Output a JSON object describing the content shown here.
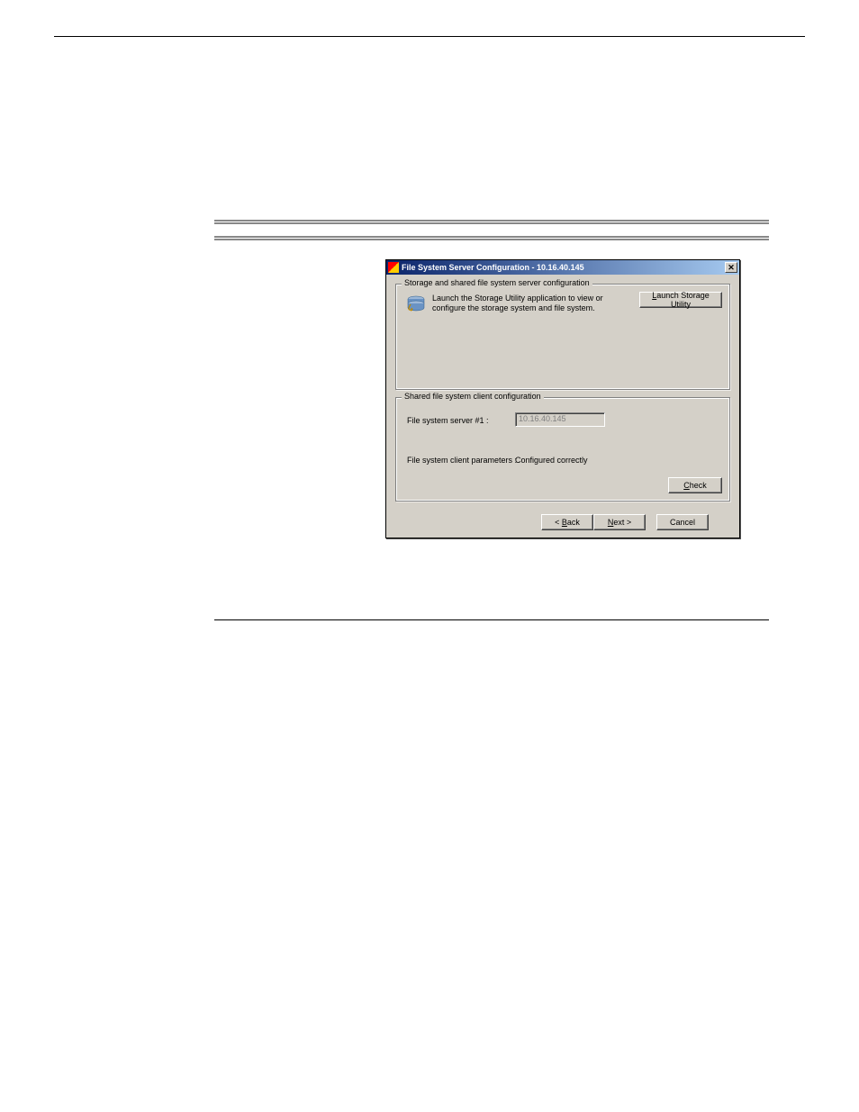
{
  "dialog": {
    "title": "File System Server Configuration - 10.16.40.145",
    "group1": {
      "legend": "Storage and shared file system server configuration",
      "description": "Launch the Storage Utility application to view or configure the storage system and file system.",
      "launch_button": "Launch Storage Utility",
      "launch_mnemonic": "L"
    },
    "group2": {
      "legend": "Shared file system client configuration",
      "server_label": "File system server #1 :",
      "server_value": "10.16.40.145",
      "params_label": "File system client parameters :",
      "params_status": "Configured correctly",
      "check_button": "Check",
      "check_mnemonic": "C"
    },
    "nav": {
      "back": "< Back",
      "back_mnemonic": "B",
      "next": "Next >",
      "next_mnemonic": "N",
      "cancel": "Cancel"
    }
  }
}
